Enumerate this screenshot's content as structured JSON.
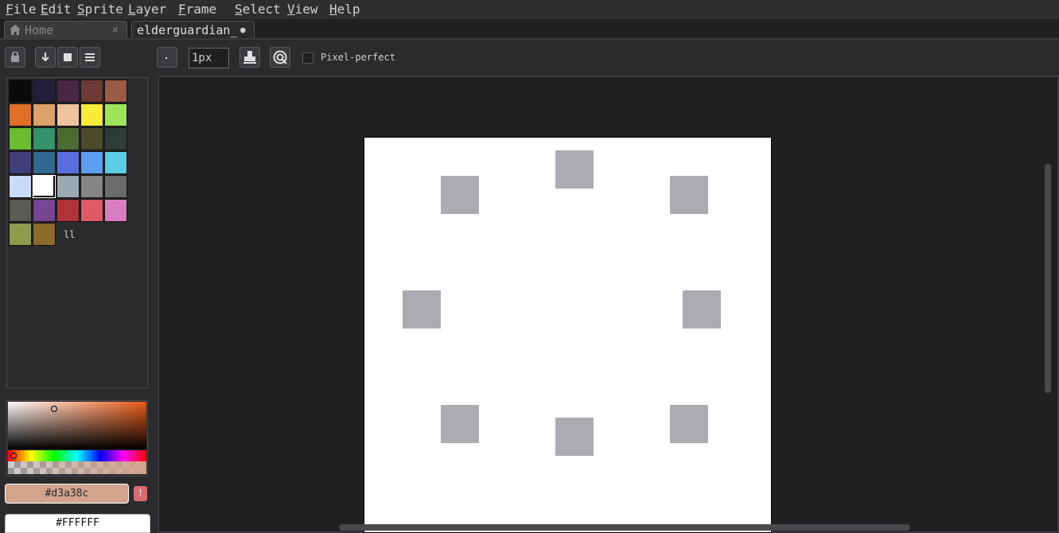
{
  "menu": {
    "items": [
      {
        "label": "File",
        "underline": "F",
        "rest": "ile"
      },
      {
        "label": "Edit",
        "underline": "E",
        "rest": "dit"
      },
      {
        "label": "Sprite",
        "underline": "S",
        "rest": "prite"
      },
      {
        "label": "Layer",
        "underline": "L",
        "rest": "ayer"
      },
      {
        "label": "Frame",
        "underline": "F",
        "rest": "rame"
      },
      {
        "label": "Select",
        "underline": "S",
        "rest": "elect"
      },
      {
        "label": "View",
        "underline": "V",
        "rest": "iew"
      },
      {
        "label": "Help",
        "underline": "H",
        "rest": "elp"
      }
    ]
  },
  "tabs": {
    "home": {
      "label": "Home",
      "close": "✕"
    },
    "document": {
      "label": "elderguardian_",
      "modified": "●"
    }
  },
  "toolbar": {
    "brush_size": "1px",
    "pixel_perfect_label": "Pixel-perfect",
    "pixel_perfect_checked": false,
    "icons": [
      "lock-icon",
      "arrow-down-icon",
      "square-icon",
      "menu-icon",
      "dot-brush-icon",
      "stamp-icon",
      "target-icon"
    ]
  },
  "palette": {
    "colors": [
      "#0a0a0c",
      "#231f3b",
      "#4a2745",
      "#6d3a34",
      "#9b5a43",
      "#e07028",
      "#dca06a",
      "#efc39c",
      "#f7ec38",
      "#9ee55a",
      "#6bbd2e",
      "#35926a",
      "#4b6d33",
      "#4c4a2a",
      "#303c38",
      "#3e3e78",
      "#306a8c",
      "#5a6ee0",
      "#5b9ef2",
      "#5bcde4",
      "#c9dbfb",
      "#ffffff",
      "#9ca9b3",
      "#858587",
      "#6b6d6c",
      "#5c5a54",
      "#774592",
      "#b0323a",
      "#de5a66",
      "#d87dc2",
      "#8f9a4a",
      "#8c6a2a"
    ],
    "selected_index": 21,
    "more_label": "ll"
  },
  "color_picker": {
    "foreground_hex": "#d3a38c",
    "background_hex": "#FFFFFF",
    "warning_icon": "!"
  }
}
